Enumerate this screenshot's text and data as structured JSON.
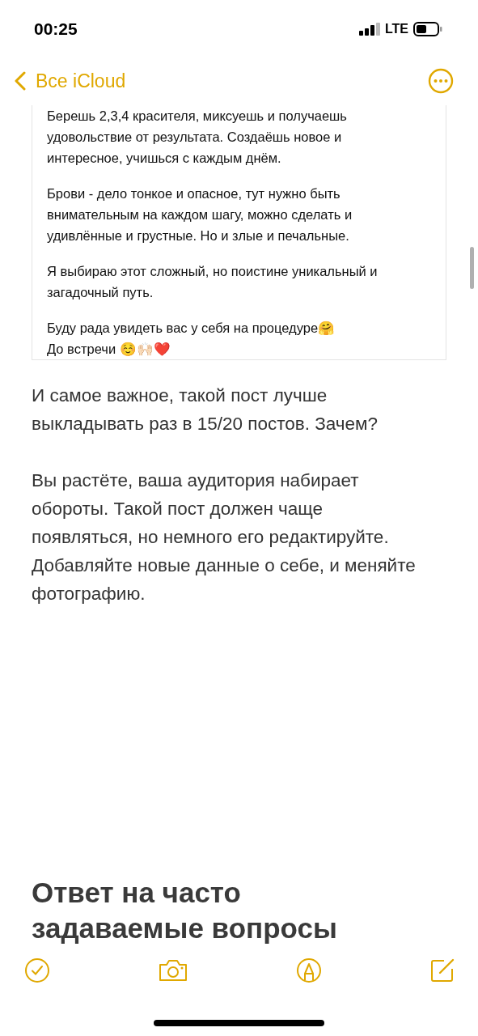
{
  "status_bar": {
    "time": "00:25",
    "network": "LTE"
  },
  "nav": {
    "back_label": "Все iCloud"
  },
  "embedded_post": {
    "paragraphs": [
      "Берешь 2,3,4 красителя, миксуешь и получаешь удовольствие от результата. Создаёшь новое и интересное, учишься с каждым днём.",
      "Брови - дело тонкое и опасное, тут нужно быть внимательным на каждом шагу, можно сделать и удивлённые и грустные. Но и злые и печальные.",
      "Я выбираю этот сложный, но поистине уникальный и загадочный путь.",
      "Буду рада увидеть вас у себя на процедуре🤗\nДо встречи ☺️🙌🏻❤️"
    ]
  },
  "note_paragraphs": [
    "И самое важное, такой пост лучше выкладывать раз в 15/20 постов. Зачем?",
    "Вы растёте, ваша аудитория набирает обороты. Такой пост должен чаще появляться, но немного его редактируйте. Добавляйте новые данные о себе, и меняйте фотографию."
  ],
  "heading": "Ответ на часто задаваемые вопросы"
}
